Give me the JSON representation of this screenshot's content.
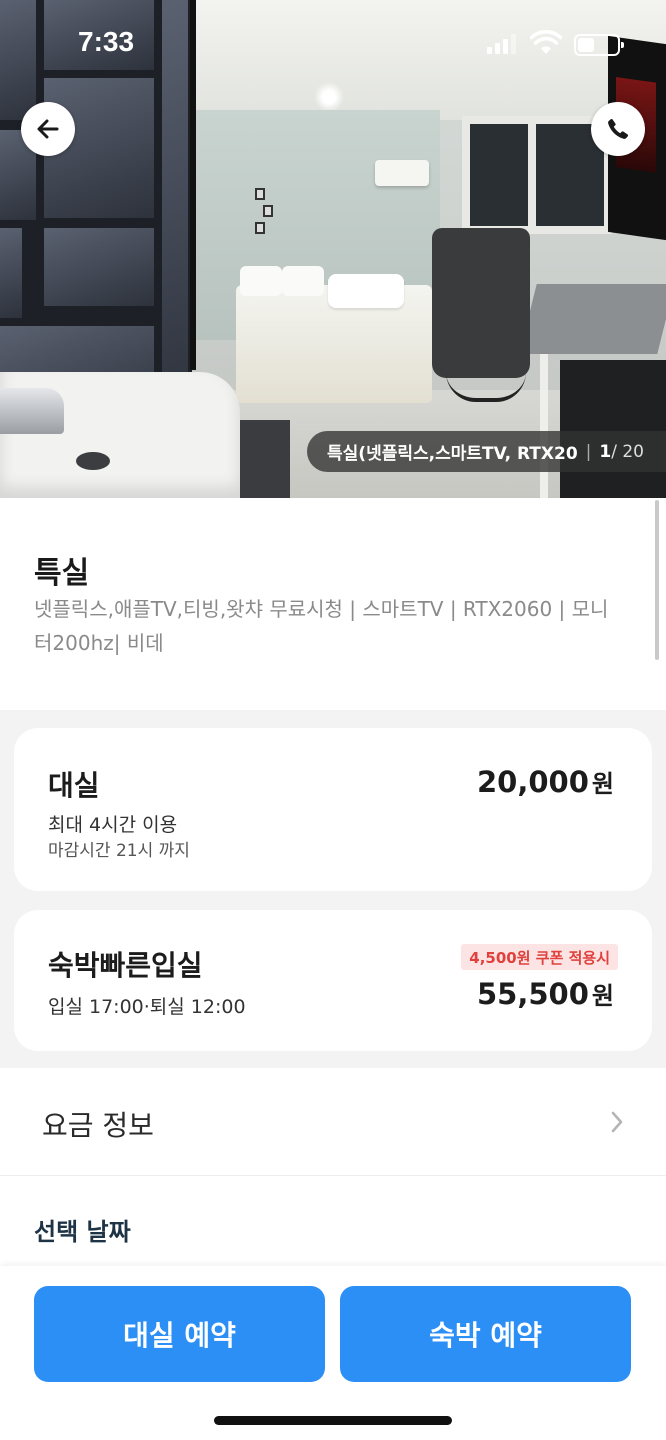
{
  "status_bar": {
    "time": "7:33"
  },
  "hero": {
    "caption_name": "특실(넷플릭스,스마트TV, RTX20",
    "caption_separator": "|",
    "photo_current": "1",
    "photo_total": "/ 20"
  },
  "room": {
    "title": "특실",
    "description": "넷플릭스,애플TV,티빙,왓챠 무료시청 | 스마트TV |  RTX2060 | 모니터200hz| 비데"
  },
  "rental": {
    "title": "대실",
    "line1": "최대 4시간 이용",
    "line2": "마감시간 21시 까지",
    "price": "20,000",
    "currency": "원"
  },
  "stay": {
    "title": "숙박빠른입실",
    "line1": "입실 17:00·퇴실 12:00",
    "coupon": "4,500원 쿠폰 적용시",
    "price": "55,500",
    "currency": "원"
  },
  "fare_info": {
    "label": "요금 정보"
  },
  "date_section": {
    "label": "선택 날짜"
  },
  "bottom": {
    "rental_button": "대실 예약",
    "stay_button": "숙박 예약"
  },
  "colors": {
    "accent": "#2b8ff5",
    "coupon_text": "#e0413c",
    "coupon_bg": "#fde4e4",
    "section_bg": "#f3f3f3"
  },
  "icons": {
    "back": "arrow-left-icon",
    "call": "phone-icon",
    "fare_chevron": "chevron-right-icon"
  }
}
